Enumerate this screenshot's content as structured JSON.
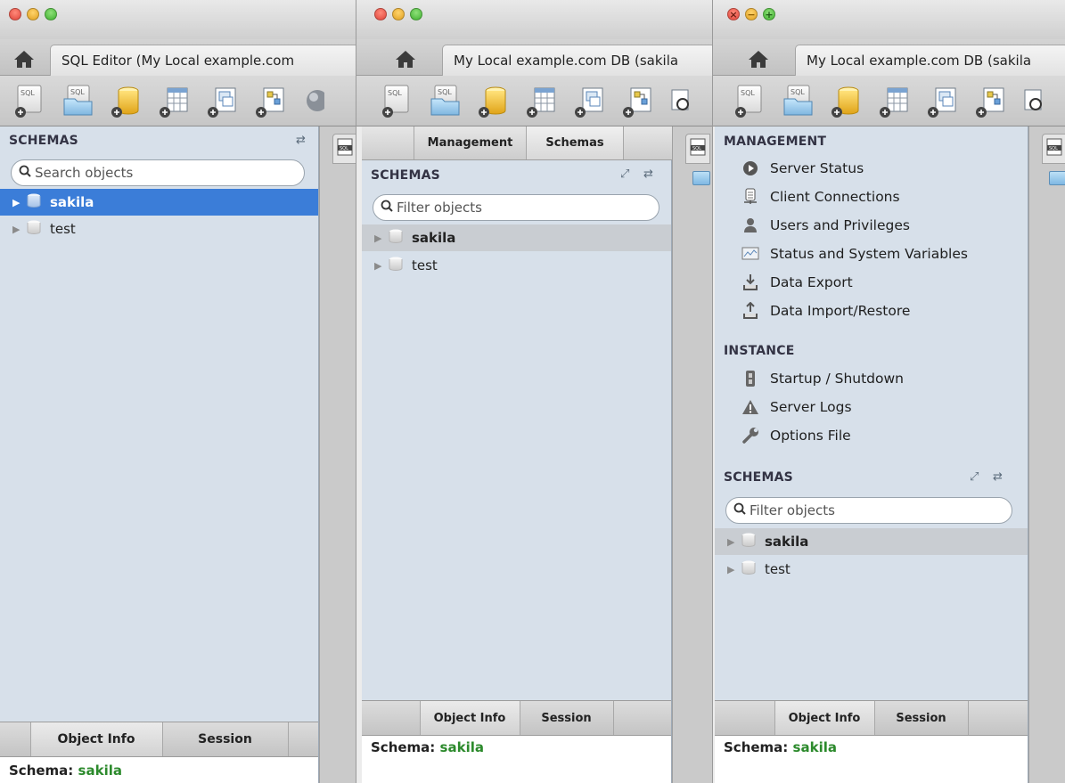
{
  "colors": {
    "selection": "#3b7dd8",
    "schema_value": "#2c8a2c",
    "sidebar_bg": "#d7e0ea"
  },
  "window1": {
    "tab_title": "SQL Editor (My Local example.com",
    "schemas_header": "SCHEMAS",
    "search_placeholder": "Search objects",
    "schemas": [
      {
        "name": "sakila"
      },
      {
        "name": "test"
      }
    ],
    "bottom_tabs": [
      "Object Info",
      "Session"
    ],
    "info_label": "Schema:",
    "info_value": "sakila"
  },
  "window2": {
    "tab_title": "My Local example.com DB (sakila",
    "segments": [
      "Management",
      "Schemas"
    ],
    "schemas_header": "SCHEMAS",
    "search_placeholder": "Filter objects",
    "schemas": [
      {
        "name": "sakila"
      },
      {
        "name": "test"
      }
    ],
    "bottom_tabs": [
      "Object Info",
      "Session"
    ],
    "info_label": "Schema:",
    "info_value": "sakila"
  },
  "window3": {
    "tab_title": "My Local example.com DB (sakila",
    "management_header": "MANAGEMENT",
    "management_items": [
      {
        "label": "Server Status",
        "icon": "server-status-icon"
      },
      {
        "label": "Client Connections",
        "icon": "client-connections-icon"
      },
      {
        "label": "Users and Privileges",
        "icon": "users-icon"
      },
      {
        "label": "Status and System Variables",
        "icon": "variables-icon"
      },
      {
        "label": "Data Export",
        "icon": "data-export-icon"
      },
      {
        "label": "Data Import/Restore",
        "icon": "data-import-icon"
      }
    ],
    "instance_header": "INSTANCE",
    "instance_items": [
      {
        "label": "Startup / Shutdown",
        "icon": "startup-icon"
      },
      {
        "label": "Server Logs",
        "icon": "server-logs-icon"
      },
      {
        "label": "Options File",
        "icon": "options-file-icon"
      }
    ],
    "schemas_header": "SCHEMAS",
    "search_placeholder": "Filter objects",
    "schemas": [
      {
        "name": "sakila"
      },
      {
        "name": "test"
      }
    ],
    "bottom_tabs": [
      "Object Info",
      "Session"
    ],
    "info_label": "Schema:",
    "info_value": "sakila"
  }
}
